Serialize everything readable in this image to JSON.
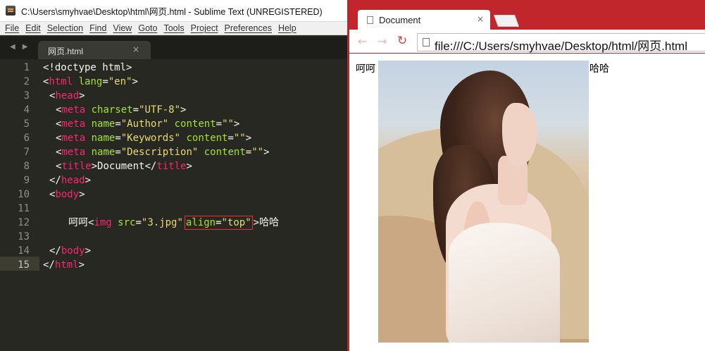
{
  "sublime": {
    "title": "C:\\Users\\smyhvae\\Desktop\\html\\网页.html - Sublime Text (UNREGISTERED)",
    "menu": [
      "File",
      "Edit",
      "Selection",
      "Find",
      "View",
      "Goto",
      "Tools",
      "Project",
      "Preferences",
      "Help"
    ],
    "tab_label": "网页.html",
    "tab_close": "×",
    "line_numbers": [
      "1",
      "2",
      "3",
      "4",
      "5",
      "6",
      "7",
      "8",
      "9",
      "10",
      "11",
      "12",
      "13",
      "14",
      "15"
    ],
    "active_line": "15",
    "code": {
      "l1": "<!doctype html>",
      "l2_open": "<",
      "l2_tag": "html",
      "l2_attr": " lang",
      "l2_eq": "=",
      "l2_val": "\"en\"",
      "l2_close": ">",
      "l3_open": "<",
      "l3_tag": "head",
      "l3_close": ">",
      "meta": "meta",
      "charset": " charset",
      "charset_val": "\"UTF-8\"",
      "name": " name",
      "content": " content",
      "author": "\"Author\"",
      "keywords": "\"Keywords\"",
      "description": "\"Description\"",
      "empty": "\"\"",
      "title_tag": "title",
      "title_text": "Document",
      "body_tag": "body",
      "l12_text_before": "呵呵",
      "img_tag": "img",
      "src": " src",
      "src_val": "\"3.jpg\"",
      "align": "align",
      "align_val": "\"top\"",
      "l12_text_after": "哈哈",
      "lt": "<",
      "gt": ">",
      "lt_slash": "</",
      "eq": "="
    }
  },
  "chrome": {
    "tab_title": "Document",
    "tab_close": "×",
    "url": "file:///C:/Users/smyhvae/Desktop/html/网页.html",
    "text_before": "呵呵",
    "text_after": "哈哈",
    "accent_color": "#c0262b"
  }
}
